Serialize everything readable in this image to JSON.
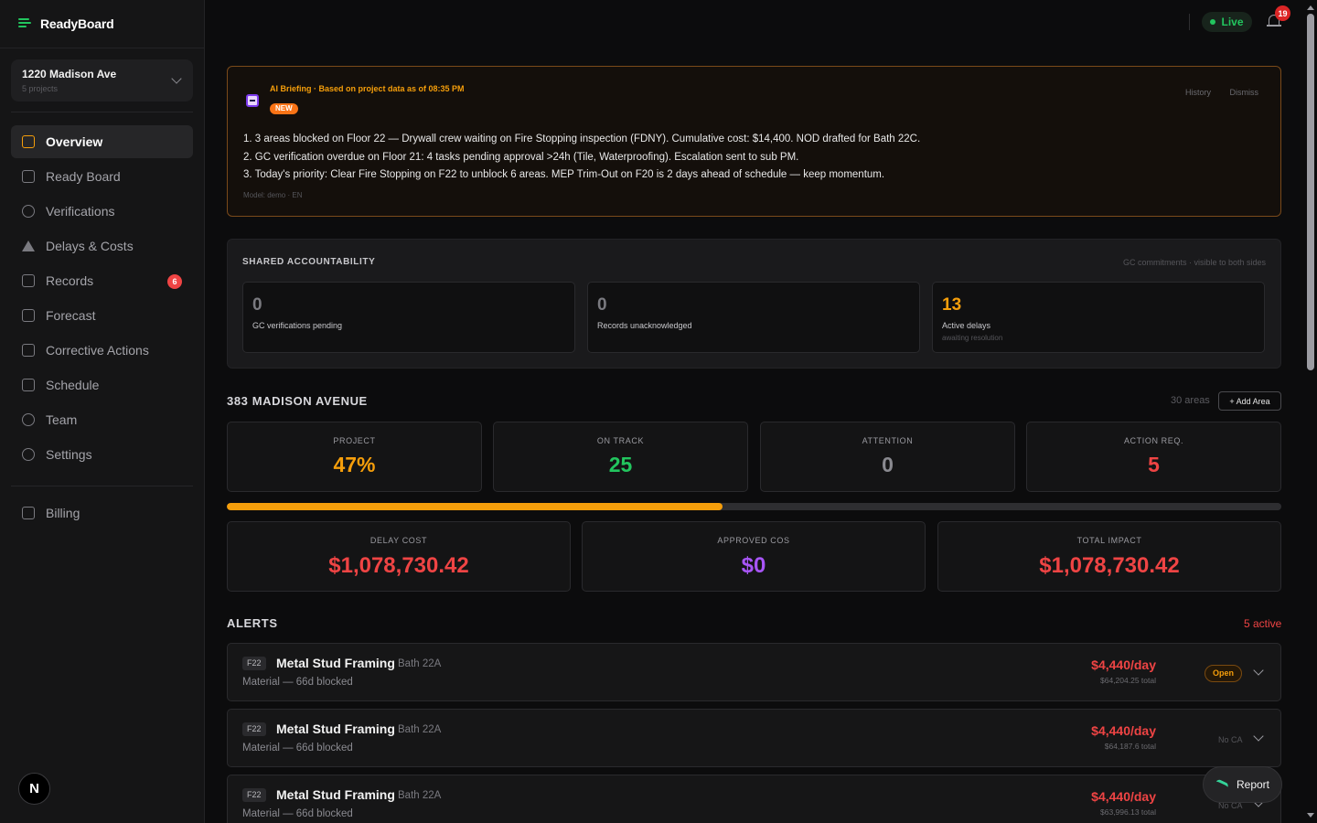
{
  "brand": {
    "name": "ReadyBoard",
    "accent": "#22c55e"
  },
  "project_switcher": {
    "name": "1220 Madison Ave",
    "sub": "5 projects"
  },
  "nav": {
    "items": [
      {
        "label": "Overview",
        "icon": "grid-icon",
        "active": true
      },
      {
        "label": "Ready Board",
        "icon": "board-icon"
      },
      {
        "label": "Verifications",
        "icon": "check-circle-icon"
      },
      {
        "label": "Delays & Costs",
        "icon": "warning-icon"
      },
      {
        "label": "Records",
        "icon": "scale-icon",
        "badge": "6"
      },
      {
        "label": "Forecast",
        "icon": "bar-chart-icon"
      },
      {
        "label": "Corrective Actions",
        "icon": "arrow-left-bar-icon"
      },
      {
        "label": "Schedule",
        "icon": "calendar-icon"
      },
      {
        "label": "Team",
        "icon": "users-icon"
      },
      {
        "label": "Settings",
        "icon": "gear-icon"
      }
    ],
    "billing": {
      "label": "Billing",
      "icon": "card-icon"
    }
  },
  "user_avatar": "N",
  "topbar": {
    "live": "Live",
    "notifications": "19"
  },
  "briefing": {
    "header": "AI Briefing · Based on project data as of 08:35 PM",
    "badge": "NEW",
    "history": "History",
    "dismiss": "Dismiss",
    "lines": [
      "1. 3 areas blocked on Floor 22 — Drywall crew waiting on Fire Stopping inspection (FDNY). Cumulative cost: $14,400. NOD drafted for Bath 22C.",
      "2. GC verification overdue on Floor 21: 4 tasks pending approval >24h (Tile, Waterproofing). Escalation sent to sub PM.",
      "3. Today's priority: Clear Fire Stopping on F22 to unblock 6 areas. MEP Trim-Out on F20 is 2 days ahead of schedule — keep momentum."
    ],
    "model": "Model: demo · EN"
  },
  "shared": {
    "title": "SHARED ACCOUNTABILITY",
    "note": "GC commitments · visible to both sides",
    "cards": [
      {
        "value": "0",
        "label": "GC verifications pending",
        "sub": ""
      },
      {
        "value": "0",
        "label": "Records unacknowledged",
        "sub": ""
      },
      {
        "value": "13",
        "label": "Active delays",
        "sub": "awaiting resolution"
      }
    ]
  },
  "project": {
    "title": "383 MADISON AVENUE",
    "areas": "30 areas",
    "add_area": "+ Add Area",
    "stats": [
      {
        "label": "PROJECT",
        "value": "47%",
        "color": "#f59e0b"
      },
      {
        "label": "ON TRACK",
        "value": "25",
        "color": "#22c55e"
      },
      {
        "label": "ATTENTION",
        "value": "0",
        "color": "#8a8a90"
      },
      {
        "label": "ACTION REQ.",
        "value": "5",
        "color": "#ef4444"
      }
    ],
    "progress_percent": 47,
    "costs": [
      {
        "label": "DELAY COST",
        "value": "$1,078,730.42",
        "color": "#ef4444"
      },
      {
        "label": "APPROVED COS",
        "value": "$0",
        "color": "#a855f7"
      },
      {
        "label": "TOTAL IMPACT",
        "value": "$1,078,730.42",
        "color": "#ef4444"
      }
    ]
  },
  "alerts": {
    "title": "ALERTS",
    "active": "5 active",
    "items": [
      {
        "floor": "F22",
        "task": "Metal Stud Framing",
        "location": "Bath 22A",
        "desc": "Material — 66d blocked",
        "rate": "$4,440/day",
        "total": "$64,204.25 total",
        "status": "Open"
      },
      {
        "floor": "F22",
        "task": "Metal Stud Framing",
        "location": "Bath 22A",
        "desc": "Material — 66d blocked",
        "rate": "$4,440/day",
        "total": "$64,187.6 total",
        "status": "No CA"
      },
      {
        "floor": "F22",
        "task": "Metal Stud Framing",
        "location": "Bath 22A",
        "desc": "Material — 66d blocked",
        "rate": "$4,440/day",
        "total": "$63,996.13 total",
        "status": "No CA"
      }
    ]
  },
  "report_button": "Report"
}
